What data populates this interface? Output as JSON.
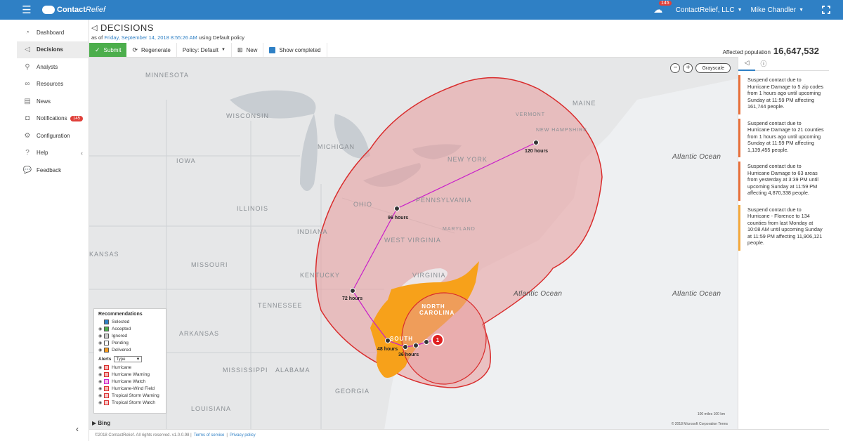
{
  "app": {
    "brand": "Contact",
    "brand_suffix": "Relief",
    "notifications_count": "145",
    "org": "ContactRelief, LLC",
    "user": "Mike Chandler"
  },
  "sidebar": {
    "items": [
      {
        "label": "Dashboard"
      },
      {
        "label": "Decisions"
      },
      {
        "label": "Analysts"
      },
      {
        "label": "Resources"
      },
      {
        "label": "News"
      },
      {
        "label": "Notifications",
        "badge": "145"
      },
      {
        "label": "Configuration"
      },
      {
        "label": "Help"
      },
      {
        "label": "Feedback"
      }
    ]
  },
  "header": {
    "title": "DECISIONS",
    "asof_prefix": "as of",
    "asof_date": "Friday, September 14, 2018 8:55:26 AM",
    "asof_suffix": "using Default policy"
  },
  "toolbar": {
    "submit": "Submit",
    "regenerate": "Regenerate",
    "policy": "Policy: Default",
    "new": "New",
    "show_completed": "Show completed"
  },
  "affected": {
    "label": "Affected population",
    "value": "16,647,532"
  },
  "map": {
    "style": "Grayscale",
    "labels": {
      "minnesota": "MINNESOTA",
      "wisconsin": "WISCONSIN",
      "michigan": "MICHIGAN",
      "iowa": "IOWA",
      "illinois": "ILLINOIS",
      "indiana": "INDIANA",
      "ohio": "OHIO",
      "pennsylvania": "PENNSYLVANIA",
      "new_york": "NEW YORK",
      "vermont": "VERMONT",
      "maine": "MAINE",
      "new_hampshire": "NEW HAMPSHIRE",
      "west_virginia": "WEST VIRGINIA",
      "virginia": "VIRGINIA",
      "maryland": "MARYLAND",
      "kentucky": "KENTUCKY",
      "missouri": "MISSOURI",
      "kansas": "KANSAS",
      "tennessee": "TENNESSEE",
      "arkansas": "ARKANSAS",
      "mississippi": "MISSISSIPPI",
      "alabama": "ALABAMA",
      "georgia": "GEORGIA",
      "louisiana": "LOUISIANA",
      "north_carolina": "NORTH CAROLINA",
      "south_carolina": "SOUTH",
      "atlantic1": "Atlantic Ocean",
      "atlantic2": "Atlantic Ocean",
      "atlantic3": "Atlantic Ocean"
    },
    "track": {
      "h120": "120 hours",
      "h96": "96 hours",
      "h72": "72 hours",
      "h48": "48 hours",
      "h36": "36 hours",
      "storm_number": "1"
    },
    "bing": "Bing",
    "scale": "100 miles     100 km",
    "copyright": "© 2018 Microsoft Corporation  Terms"
  },
  "legend": {
    "recommendations_title": "Recommendations",
    "recommendations": [
      {
        "label": "Selected",
        "color": "#2f80c5"
      },
      {
        "label": "Accepted",
        "color": "#4cae4c"
      },
      {
        "label": "Ignored",
        "color": "#cccccc"
      },
      {
        "label": "Pending",
        "color": "#ffffff"
      },
      {
        "label": "Delivered",
        "color": "#f49a1e"
      }
    ],
    "alerts_title": "Alerts",
    "alerts_type": "Type",
    "alerts": [
      {
        "label": "Hurricane",
        "color": "#f5b5b5"
      },
      {
        "label": "Hurricane Warning",
        "color": "#f5b5b5"
      },
      {
        "label": "Hurricane Watch",
        "color": "#f7b8e8"
      },
      {
        "label": "Hurricane-Wind Field",
        "color": "#f5b5b5"
      },
      {
        "label": "Tropical Storm Warning",
        "color": "#f5c8c8"
      },
      {
        "label": "Tropical Storm Watch",
        "color": "#f5c8c8"
      }
    ]
  },
  "decisions": [
    {
      "text": "Suspend contact due to Hurricane Damage to 5 zip codes from 1 hours ago until upcoming Sunday at 11:59 PM affecting 161,744 people."
    },
    {
      "text": "Suspend contact due to Hurricane Damage to 21 counties from 1 hours ago until upcoming Sunday at 11:59 PM affecting 1,139,455 people."
    },
    {
      "text": "Suspend contact due to Hurricane Damage to 63 areas from yesterday at 3:39 PM until upcoming Sunday at 11:59 PM affecting 4,870,338 people."
    },
    {
      "text": "Suspend contact due to Hurricane - Florence to 134 counties from last Monday at 10:08 AM until upcoming Sunday at 11:59 PM affecting 11,906,121 people."
    }
  ],
  "footer": {
    "copyright": "©2018 ContactRelief. All rights reserved. v1.0.0.98 |",
    "terms": "Terms of service",
    "sep": "|",
    "privacy": "Privacy policy"
  }
}
